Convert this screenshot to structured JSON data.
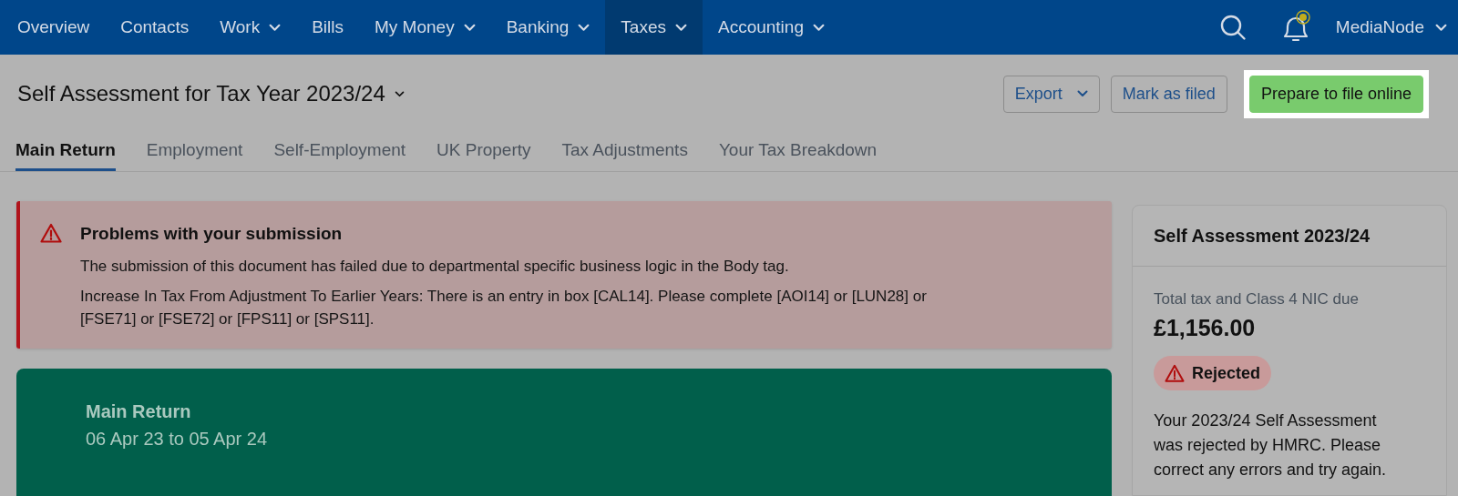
{
  "nav": {
    "items": [
      {
        "label": "Overview",
        "dropdown": false,
        "selected": false
      },
      {
        "label": "Contacts",
        "dropdown": false,
        "selected": false
      },
      {
        "label": "Work",
        "dropdown": true,
        "selected": false
      },
      {
        "label": "Bills",
        "dropdown": false,
        "selected": false
      },
      {
        "label": "My Money",
        "dropdown": true,
        "selected": false
      },
      {
        "label": "Banking",
        "dropdown": true,
        "selected": false
      },
      {
        "label": "Taxes",
        "dropdown": true,
        "selected": true
      },
      {
        "label": "Accounting",
        "dropdown": true,
        "selected": false
      }
    ],
    "account": "MediaNode"
  },
  "header": {
    "title": "Self Assessment for Tax Year 2023/24",
    "buttons": [
      {
        "label": "Export",
        "kind": "dropdown",
        "highlighted": false
      },
      {
        "label": "Mark as filed",
        "kind": "plain",
        "highlighted": false
      },
      {
        "label": "Prepare to file online",
        "kind": "primary",
        "highlighted": true
      }
    ]
  },
  "tabs": [
    {
      "label": "Main Return",
      "selected": true
    },
    {
      "label": "Employment",
      "selected": false
    },
    {
      "label": "Self-Employment",
      "selected": false
    },
    {
      "label": "UK Property",
      "selected": false
    },
    {
      "label": "Tax Adjustments",
      "selected": false
    },
    {
      "label": "Your Tax Breakdown",
      "selected": false
    }
  ],
  "alert": {
    "title": "Problems with your submission",
    "messages": [
      "The submission of this document has failed due to departmental specific business logic in the Body tag.",
      "Increase In Tax From Adjustment To Earlier Years: There is an entry in box [CAL14]. Please complete [AOI14] or [LUN28] or [FSE71] or [FSE72] or [FPS11] or [SPS11]."
    ]
  },
  "return_card": {
    "title": "Main Return",
    "period": "06 Apr 23 to 05 Apr 24"
  },
  "summary": {
    "title": "Self Assessment 2023/24",
    "label": "Total tax and Class 4 NIC due",
    "amount": "£1,156.00",
    "status": "Rejected",
    "message": "Your 2023/24 Self Assessment was rejected by HMRC. Please correct any errors and try again."
  }
}
